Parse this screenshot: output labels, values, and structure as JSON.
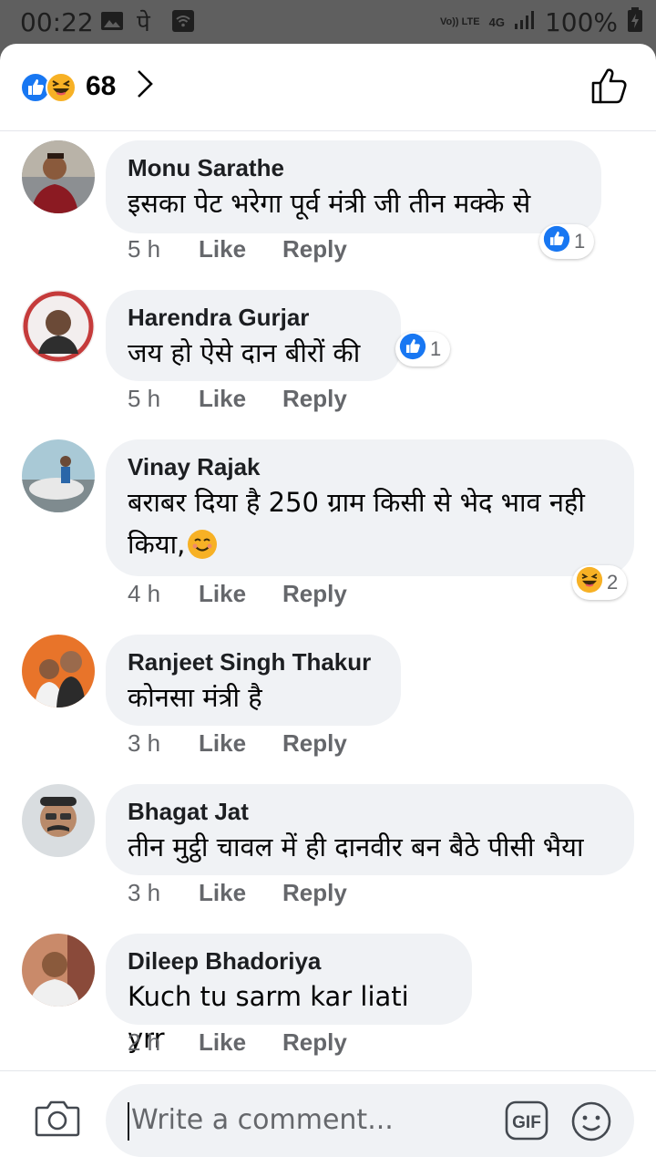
{
  "status_bar": {
    "time": "00:22",
    "app_glyph": "पे",
    "network_badge": "Vo)) LTE",
    "network_type": "4G",
    "battery": "100%"
  },
  "header": {
    "reaction_count": "68",
    "reaction_icons": [
      "like-icon",
      "haha-icon"
    ]
  },
  "colors": {
    "like_blue": "#1877f2",
    "haha_yellow": "#f7b125",
    "bubble_bg": "#f0f2f5",
    "meta_gray": "#65676b"
  },
  "comments": [
    {
      "author": "Monu Sarathe",
      "text": "इसका पेट भरेगा  पूर्व मंत्री जी  तीन  मक्के से",
      "time": "5 h",
      "like_label": "Like",
      "reply_label": "Reply",
      "reaction": {
        "icon": "like-icon",
        "count": "1"
      }
    },
    {
      "author": "Harendra Gurjar",
      "text": "जय हो ऐसे दान बीरों की",
      "time": "5 h",
      "like_label": "Like",
      "reply_label": "Reply",
      "reaction": {
        "icon": "like-icon",
        "count": "1"
      }
    },
    {
      "author": "Vinay Rajak",
      "text": "बराबर दिया है 250 ग्राम किसी से भेद भाव नही",
      "text2": "किया,",
      "time": "4 h",
      "like_label": "Like",
      "reply_label": "Reply",
      "reaction": {
        "icon": "haha-icon",
        "count": "2"
      }
    },
    {
      "author": "Ranjeet Singh Thakur",
      "text": "कोनसा मंत्री  है",
      "time": "3 h",
      "like_label": "Like",
      "reply_label": "Reply"
    },
    {
      "author": "Bhagat Jat",
      "text": "तीन मुट्ठी चावल में ही दानवीर बन बैठे पीसी भैया",
      "time": "3 h",
      "like_label": "Like",
      "reply_label": "Reply"
    },
    {
      "author": "Dileep Bhadoriya",
      "text": "Kuch tu sarm kar liati yrr",
      "time": "2 h",
      "like_label": "Like",
      "reply_label": "Reply"
    }
  ],
  "composer": {
    "placeholder": "Write a comment...",
    "gif_label": "GIF"
  }
}
